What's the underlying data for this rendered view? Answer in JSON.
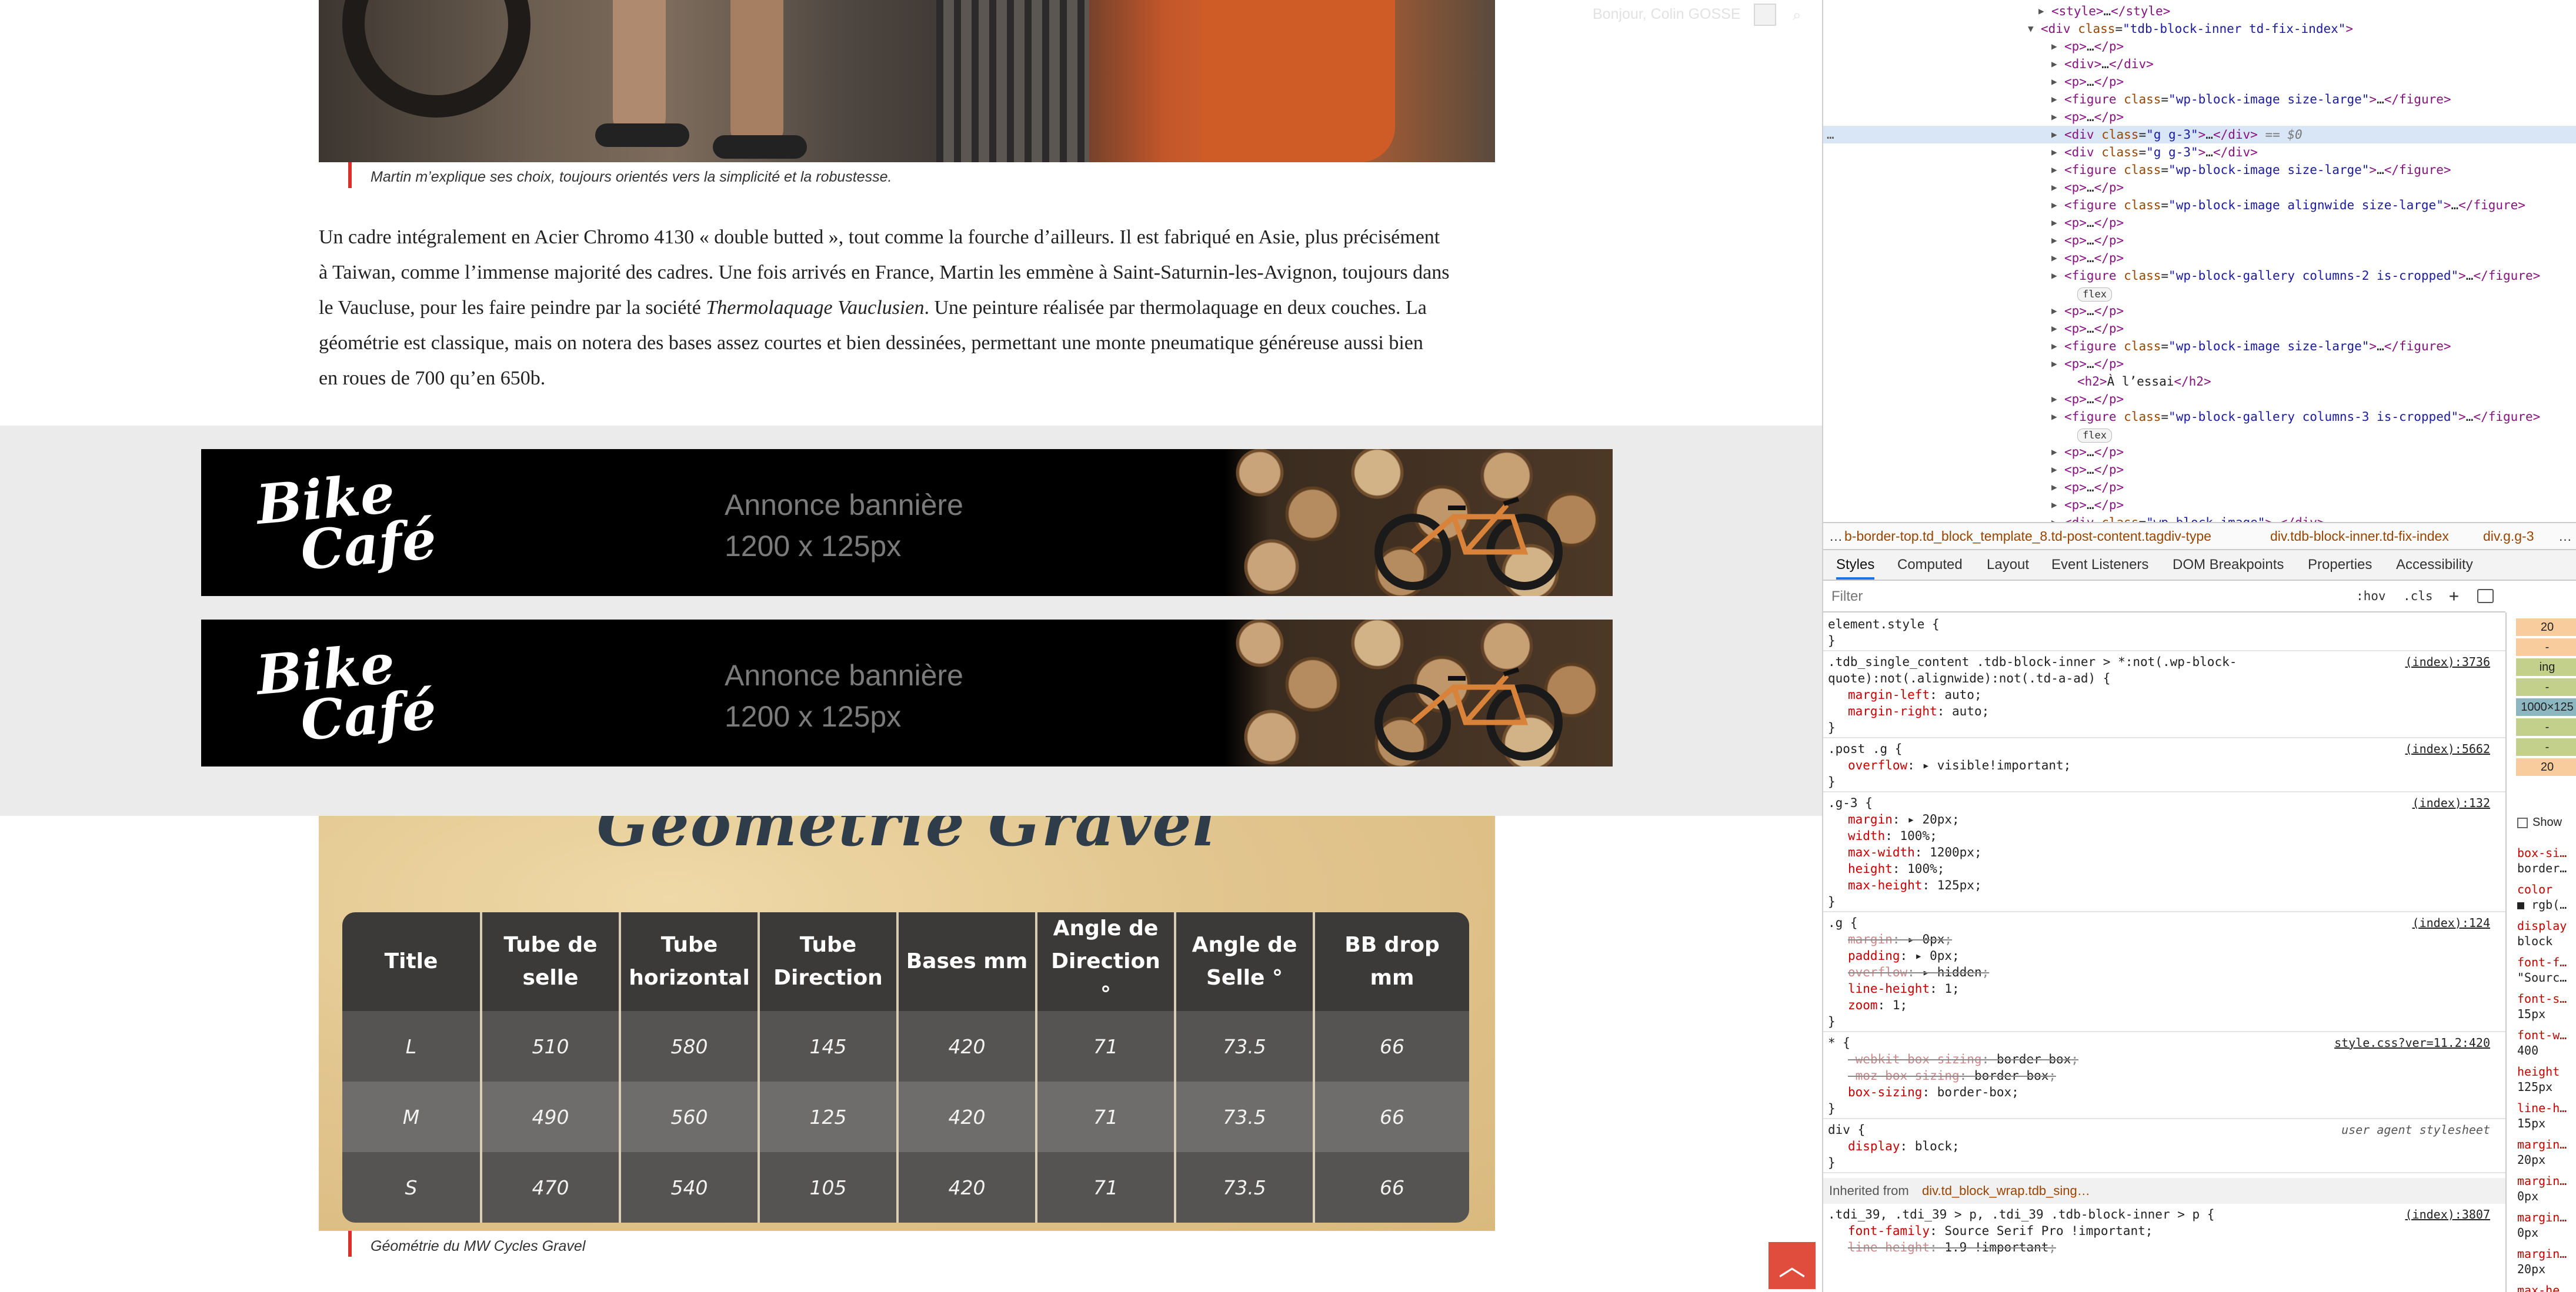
{
  "page": {
    "caption_top": "Martin m’explique ses choix, toujours orientés vers la simplicité et la robustesse.",
    "paragraph": {
      "line1": "Un cadre  intégralement en Acier Chromo 4130 « double butted », tout comme la fourche d’ailleurs. Il est fabriqué en Asie, plus précisément",
      "line2": "à Taiwan, comme l’immense majorité des cadres. Une fois arrivés en France, Martin les emmène à Saint-Saturnin-les-Avignon, toujours dans",
      "line3_before": "le Vaucluse, pour les faire peindre par la société ",
      "line3_italic": "Thermolaquage Vauclusien",
      "line3_after": ".  Une peinture réalisée par thermolaquage en deux couches. La",
      "line4": "géométrie est classique, mais on notera des bases assez courtes et bien dessinées, permettant une monte pneumatique généreuse aussi bien",
      "line5": "en roues de 700 qu’en 650b."
    },
    "banner": {
      "logo_line1": "Bike",
      "logo_line2": "Café",
      "ad_line1": "Annonce bannière",
      "ad_line2": "1200 x 125px"
    },
    "geometry": {
      "title": "Géométrie Gravel",
      "headers": [
        "Title",
        "Tube de selle",
        "Tube horizontal",
        "Tube Direction",
        "Bases mm",
        "Angle de Direction °",
        "Angle de Selle °",
        "BB drop mm"
      ],
      "rows": [
        [
          "L",
          "510",
          "580",
          "145",
          "420",
          "71",
          "73.5",
          "66"
        ],
        [
          "M",
          "490",
          "560",
          "125",
          "420",
          "71",
          "73.5",
          "66"
        ],
        [
          "S",
          "470",
          "540",
          "105",
          "420",
          "71",
          "73.5",
          "66"
        ]
      ]
    },
    "caption_bottom": "Géométrie du MW Cycles Gravel",
    "user_greeting": "Bonjour, Colin GOSSE",
    "scroll_top_icon": "arrow-up-icon",
    "accent_color": "#d9322b"
  },
  "devtools": {
    "dom_rows": [
      {
        "indent": 0,
        "open": false,
        "html": "<span class='tag'>&lt;style&gt;</span><span class='plain'>…</span><span class='tag'>&lt;/style&gt;</span>"
      },
      {
        "indent": -1,
        "open": true,
        "html": "<span class='tag'>&lt;div</span> <span class='attr'>class</span>=<span class='val'>\"tdb-block-inner td-fix-index\"</span><span class='tag'>&gt;</span>"
      },
      {
        "indent": 1,
        "open": false,
        "html": "<span class='tag'>&lt;p&gt;</span>…<span class='tag'>&lt;/p&gt;</span>"
      },
      {
        "indent": 1,
        "open": false,
        "html": "<span class='tag'>&lt;div&gt;</span>…<span class='tag'>&lt;/div&gt;</span>"
      },
      {
        "indent": 1,
        "open": false,
        "html": "<span class='tag'>&lt;p&gt;</span>…<span class='tag'>&lt;/p&gt;</span>"
      },
      {
        "indent": 1,
        "open": false,
        "html": "<span class='tag'>&lt;figure</span> <span class='attr'>class</span>=<span class='val'>\"wp-block-image size-large\"</span><span class='tag'>&gt;</span>…<span class='tag'>&lt;/figure&gt;</span>"
      },
      {
        "indent": 1,
        "open": false,
        "html": "<span class='tag'>&lt;p&gt;</span>…<span class='tag'>&lt;/p&gt;</span>"
      },
      {
        "indent": 1,
        "open": false,
        "sel": true,
        "html": "<span class='tag'>&lt;div</span> <span class='attr'>class</span>=<span class='val'>\"g g-3\"</span><span class='tag'>&gt;</span>…<span class='tag'>&lt;/div&gt;</span> <span class='eq'>== $0</span>"
      },
      {
        "indent": 1,
        "open": false,
        "html": "<span class='tag'>&lt;div</span> <span class='attr'>class</span>=<span class='val'>\"g g-3\"</span><span class='tag'>&gt;</span>…<span class='tag'>&lt;/div&gt;</span>"
      },
      {
        "indent": 1,
        "open": false,
        "html": "<span class='tag'>&lt;figure</span> <span class='attr'>class</span>=<span class='val'>\"wp-block-image size-large\"</span><span class='tag'>&gt;</span>…<span class='tag'>&lt;/figure&gt;</span>"
      },
      {
        "indent": 1,
        "open": false,
        "html": "<span class='tag'>&lt;p&gt;</span>…<span class='tag'>&lt;/p&gt;</span>"
      },
      {
        "indent": 1,
        "open": false,
        "html": "<span class='tag'>&lt;figure</span> <span class='attr'>class</span>=<span class='val'>\"wp-block-image alignwide size-large\"</span><span class='tag'>&gt;</span>…<span class='tag'>&lt;/figure&gt;</span>"
      },
      {
        "indent": 1,
        "open": false,
        "html": "<span class='tag'>&lt;p&gt;</span>…<span class='tag'>&lt;/p&gt;</span>"
      },
      {
        "indent": 1,
        "open": false,
        "html": "<span class='tag'>&lt;p&gt;</span>…<span class='tag'>&lt;/p&gt;</span>"
      },
      {
        "indent": 1,
        "open": false,
        "html": "<span class='tag'>&lt;p&gt;</span>…<span class='tag'>&lt;/p&gt;</span>"
      },
      {
        "indent": 1,
        "open": false,
        "html": "<span class='tag'>&lt;figure</span> <span class='attr'>class</span>=<span class='val'>\"wp-block-gallery columns-2 is-cropped\"</span><span class='tag'>&gt;</span>…<span class='tag'>&lt;/figure&gt;</span>"
      },
      {
        "indent": 2,
        "badge": true,
        "html": "<span class='badge'>flex</span>"
      },
      {
        "indent": 1,
        "open": false,
        "html": "<span class='tag'>&lt;p&gt;</span>…<span class='tag'>&lt;/p&gt;</span>"
      },
      {
        "indent": 1,
        "open": false,
        "html": "<span class='tag'>&lt;p&gt;</span>…<span class='tag'>&lt;/p&gt;</span>"
      },
      {
        "indent": 1,
        "open": false,
        "html": "<span class='tag'>&lt;figure</span> <span class='attr'>class</span>=<span class='val'>\"wp-block-image size-large\"</span><span class='tag'>&gt;</span>…<span class='tag'>&lt;/figure&gt;</span>"
      },
      {
        "indent": 1,
        "open": false,
        "html": "<span class='tag'>&lt;p&gt;</span>…<span class='tag'>&lt;/p&gt;</span>"
      },
      {
        "indent": 2,
        "noarrow": true,
        "html": "<span class='tag'>&lt;h2&gt;</span>À l’essai<span class='tag'>&lt;/h2&gt;</span>"
      },
      {
        "indent": 1,
        "open": false,
        "html": "<span class='tag'>&lt;p&gt;</span>…<span class='tag'>&lt;/p&gt;</span>"
      },
      {
        "indent": 1,
        "open": false,
        "html": "<span class='tag'>&lt;figure</span> <span class='attr'>class</span>=<span class='val'>\"wp-block-gallery columns-3 is-cropped\"</span><span class='tag'>&gt;</span>…<span class='tag'>&lt;/figure&gt;</span>"
      },
      {
        "indent": 2,
        "badge": true,
        "html": "<span class='badge'>flex</span>"
      },
      {
        "indent": 1,
        "open": false,
        "html": "<span class='tag'>&lt;p&gt;</span>…<span class='tag'>&lt;/p&gt;</span>"
      },
      {
        "indent": 1,
        "open": false,
        "html": "<span class='tag'>&lt;p&gt;</span>…<span class='tag'>&lt;/p&gt;</span>"
      },
      {
        "indent": 1,
        "open": false,
        "html": "<span class='tag'>&lt;p&gt;</span>…<span class='tag'>&lt;/p&gt;</span>"
      },
      {
        "indent": 1,
        "open": false,
        "html": "<span class='tag'>&lt;p&gt;</span>…<span class='tag'>&lt;/p&gt;</span>"
      },
      {
        "indent": 1,
        "open": false,
        "html": "<span class='tag'>&lt;div</span> <span class='attr'>class</span>=<span class='val'>\"wp-block-image\"</span><span class='tag'>&gt;</span>…<span class='tag'>&lt;/div&gt;</span>"
      }
    ],
    "selected_marker": "…",
    "breadcrumbs": {
      "ellipsis": "…",
      "c1": "b-border-top.td_block_template_8.td-post-content.tagdiv-type",
      "c2": "div.tdb-block-inner.td-fix-index",
      "c3": "div.g.g-3",
      "more": "…"
    },
    "tabs": [
      "Styles",
      "Computed",
      "Layout",
      "Event Listeners",
      "DOM Breakpoints",
      "Properties",
      "Accessibility"
    ],
    "filter_placeholder": "Filter",
    "filter_hov": ":hov",
    "filter_cls": ".cls",
    "filter_plus": "+",
    "rules": [
      {
        "lines": [
          "element.style {",
          "}"
        ]
      },
      {
        "selector": ".tdb_single_content .tdb-block-inner > *:not(.wp-block-",
        "selector2": "quote):not(.alignwide):not(.td-a-ad) {",
        "source": "(index):3736",
        "props": [
          [
            "margin-left",
            "auto",
            false
          ],
          [
            "margin-right",
            "auto",
            false
          ]
        ]
      },
      {
        "selector": ".post .g {",
        "source": "(index):5662",
        "props": [
          [
            "overflow",
            "▸ visible!important",
            false
          ]
        ]
      },
      {
        "selector": ".g-3 {",
        "source": "(index):132",
        "props": [
          [
            "margin",
            "▸ 20px",
            false
          ],
          [
            "width",
            "100%",
            false
          ],
          [
            "max-width",
            "1200px",
            false
          ],
          [
            "height",
            "100%",
            false
          ],
          [
            "max-height",
            "125px",
            false
          ]
        ]
      },
      {
        "selector": ".g {",
        "source": "(index):124",
        "props": [
          [
            "margin",
            "▸ 0px",
            true
          ],
          [
            "padding",
            "▸ 0px",
            false
          ],
          [
            "overflow",
            "▸ hidden",
            true
          ],
          [
            "line-height",
            "1",
            false
          ],
          [
            "zoom",
            "1",
            false
          ]
        ]
      },
      {
        "selector": "* {",
        "source": "style.css?ver=11.2:420",
        "props": [
          [
            "-webkit-box-sizing",
            "border-box",
            true
          ],
          [
            "-moz-box-sizing",
            "border-box",
            true
          ],
          [
            "box-sizing",
            "border-box",
            false
          ]
        ]
      },
      {
        "selector": "div {",
        "source": "user agent stylesheet",
        "ua": true,
        "props": [
          [
            "display",
            "block",
            false
          ]
        ]
      }
    ],
    "inherited_label": "Inherited from",
    "inherited_selector": "div.td_block_wrap.tdb_sing…",
    "last_rule": {
      "selector": ".tdi_39, .tdi_39 > p, .tdi_39 .tdb-block-inner > p {",
      "source": "(index):3807",
      "props": [
        [
          "font-family",
          "Source Serif Pro !important",
          false
        ],
        [
          "line-height",
          "1.9 !important",
          true
        ]
      ]
    },
    "box_model": [
      "20",
      "-",
      "ing",
      "-",
      "1000×125",
      "-",
      "-",
      "20"
    ],
    "show_all": "Show",
    "computed": [
      [
        "box-si…",
        "border…"
      ],
      [
        "color",
        "■ rgb(…"
      ],
      [
        "display",
        "block"
      ],
      [
        "font-f…",
        "\"Sourc…"
      ],
      [
        "font-s…",
        "15px"
      ],
      [
        "font-w…",
        "400"
      ],
      [
        "height",
        "125px"
      ],
      [
        "line-h…",
        "15px"
      ],
      [
        "margin…",
        "20px"
      ],
      [
        "margin…",
        "0px"
      ],
      [
        "margin…",
        "0px"
      ],
      [
        "margin…",
        "20px"
      ],
      [
        "max-he…",
        ""
      ]
    ]
  }
}
